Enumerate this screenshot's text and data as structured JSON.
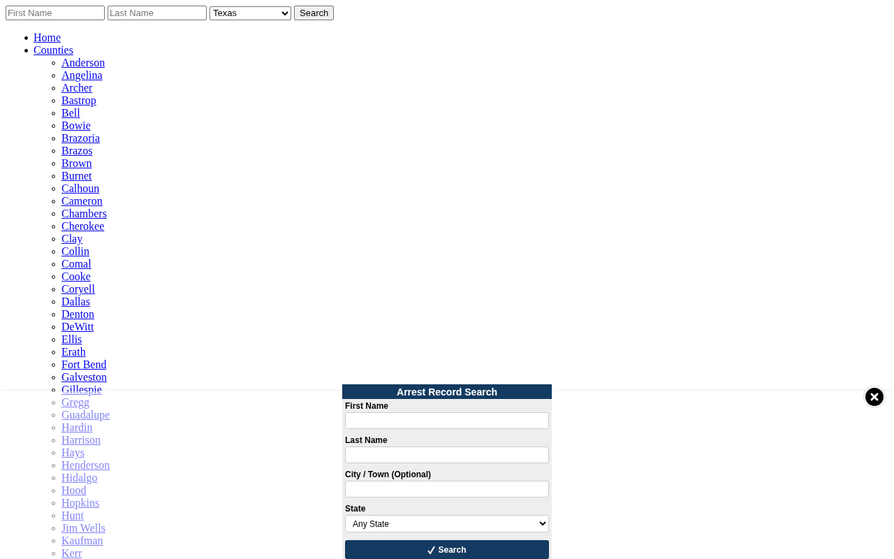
{
  "search_bar": {
    "fields": [
      {
        "placeholder": "First Name"
      },
      {
        "placeholder": "Last Name"
      }
    ],
    "state_select": {
      "value": "Texas"
    },
    "button": "Search"
  },
  "nav": [
    {
      "label": "Home"
    },
    {
      "label": "Counties",
      "children": [
        {
          "label": "Anderson"
        },
        {
          "label": "Angelina"
        },
        {
          "label": "Archer"
        },
        {
          "label": "Bastrop"
        },
        {
          "label": "Bell"
        },
        {
          "label": "Bowie"
        },
        {
          "label": "Brazoria"
        },
        {
          "label": "Brazos"
        },
        {
          "label": "Brown"
        },
        {
          "label": "Burnet"
        },
        {
          "label": "Calhoun"
        },
        {
          "label": "Cameron"
        },
        {
          "label": "Chambers"
        },
        {
          "label": "Cherokee"
        },
        {
          "label": "Clay"
        },
        {
          "label": "Collin"
        },
        {
          "label": "Comal"
        },
        {
          "label": "Cooke"
        },
        {
          "label": "Coryell"
        },
        {
          "label": "Dallas"
        },
        {
          "label": "Denton"
        },
        {
          "label": "DeWitt"
        },
        {
          "label": "Ellis"
        },
        {
          "label": "Erath"
        },
        {
          "label": "Fort Bend"
        },
        {
          "label": "Galveston"
        },
        {
          "label": "Gillespie"
        },
        {
          "label": "Gregg"
        },
        {
          "label": "Guadalupe"
        },
        {
          "label": "Hardin"
        },
        {
          "label": "Harrison"
        },
        {
          "label": "Hays"
        },
        {
          "label": "Henderson"
        },
        {
          "label": "Hidalgo"
        },
        {
          "label": "Hood"
        },
        {
          "label": "Hopkins"
        },
        {
          "label": "Hunt"
        },
        {
          "label": "Jim Wells"
        },
        {
          "label": "Kaufman"
        },
        {
          "label": "Kerr"
        }
      ]
    }
  ],
  "popup": {
    "title": "Arrest Record Search",
    "fields": [
      {
        "kind": "text",
        "label": "First Name"
      },
      {
        "kind": "text",
        "label": "Last Name"
      },
      {
        "kind": "text",
        "label": "City / Town (Optional)"
      },
      {
        "kind": "select",
        "label": "State",
        "value": "Any State"
      }
    ],
    "button": "Search"
  }
}
